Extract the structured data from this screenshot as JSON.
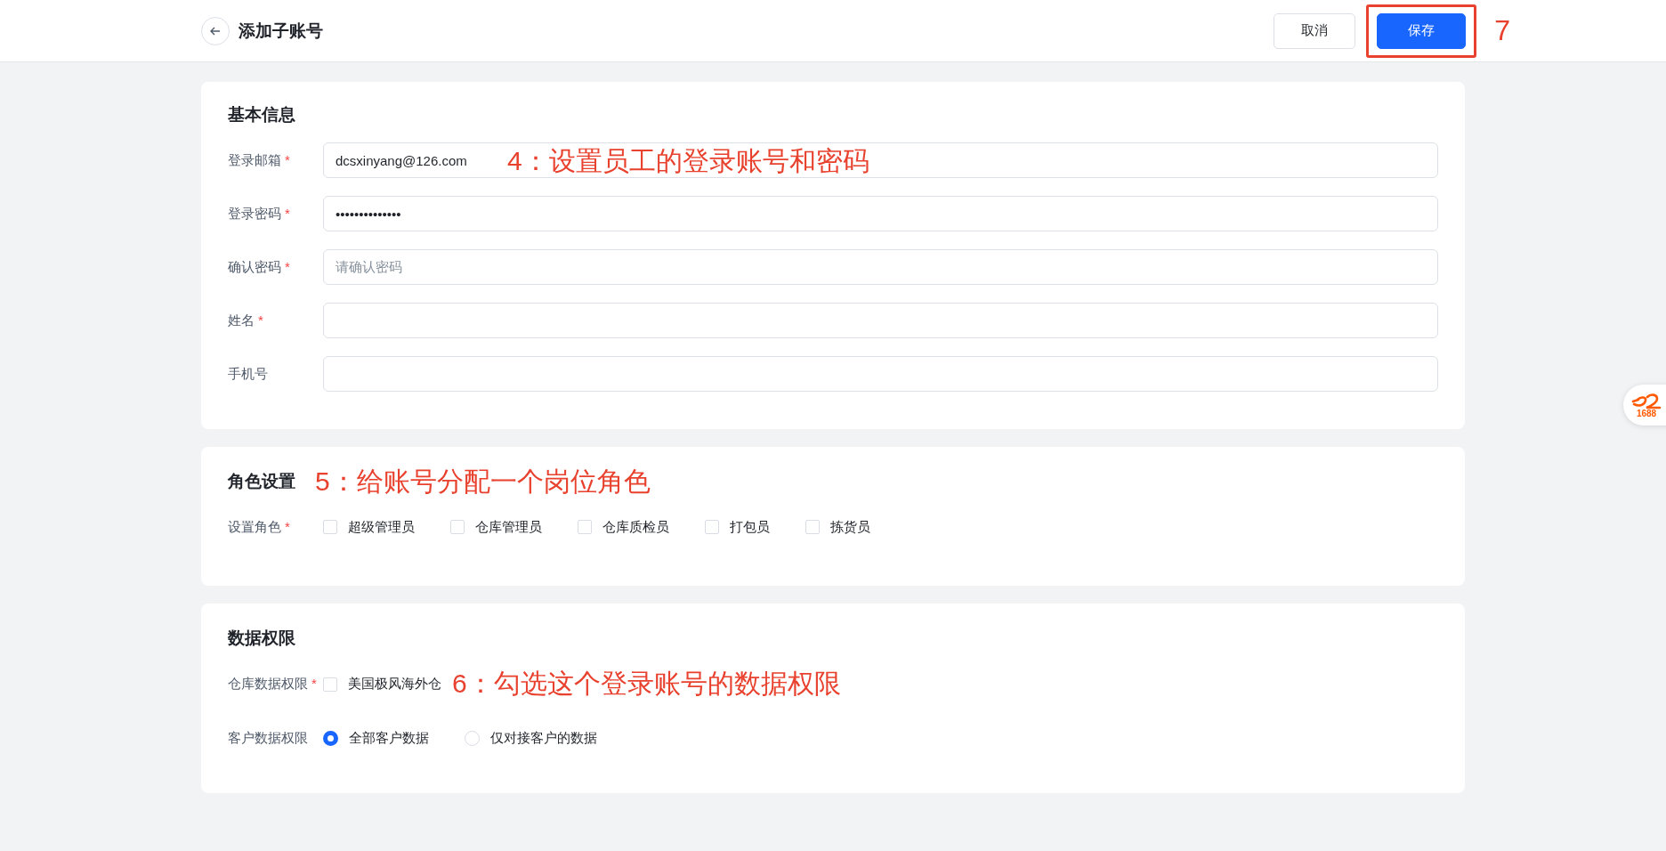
{
  "header": {
    "title": "添加子账号",
    "buttons": [
      {
        "label": "取消",
        "kind": "default",
        "highlighted": false
      },
      {
        "label": "保存",
        "kind": "primary",
        "highlighted": true
      }
    ],
    "step_note": "7"
  },
  "sections": [
    {
      "kind": "fields",
      "title": "基本信息",
      "annotation": "4：设置员工的登录账号和密码",
      "fields": [
        {
          "label": "登录邮箱",
          "mark": "*",
          "value": "dcsxinyang@126.com"
        },
        {
          "label": "登录密码",
          "mark": "*",
          "value": "••••••••••••••"
        },
        {
          "label": "确认密码",
          "mark": "*",
          "placeholder": "请确认密码"
        },
        {
          "label": "姓名",
          "mark": "*"
        },
        {
          "label": "手机号"
        }
      ]
    },
    {
      "kind": "roles",
      "title": "角色设置",
      "annotation": "5：给账号分配一个岗位角色",
      "label": "设置角色",
      "mark": "*",
      "options": [
        {
          "label": "超级管理员",
          "checked": false
        },
        {
          "label": "仓库管理员",
          "checked": false
        },
        {
          "label": "仓库质检员",
          "checked": false
        },
        {
          "label": "打包员",
          "checked": false
        },
        {
          "label": "拣货员",
          "checked": false
        }
      ]
    },
    {
      "kind": "permissions",
      "title": "数据权限",
      "annotation": "6：勾选这个登录账号的数据权限",
      "warehouse": {
        "label": "仓库数据权限",
        "mark": "*",
        "options": [
          {
            "label": "美国极风海外仓",
            "checked": false
          }
        ]
      },
      "customer": {
        "label": "客户数据权限",
        "options": [
          {
            "label": "全部客户数据",
            "selected": true
          },
          {
            "label": "仅对接客户的数据",
            "selected": false
          }
        ]
      }
    }
  ],
  "floating_badge": {
    "text": "1688"
  }
}
